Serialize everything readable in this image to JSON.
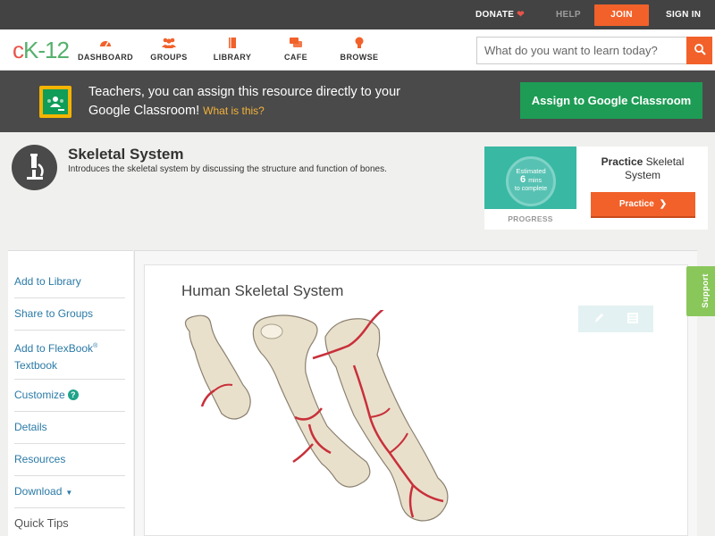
{
  "topbar": {
    "donate": "DONATE",
    "help": "HELP",
    "join": "JOIN",
    "sign_in": "SIGN IN"
  },
  "brand": {
    "logo_c": "c",
    "logo_k": "K",
    "logo_12": "-12",
    "accent_color": "#f2612a",
    "green_color": "#56b06c"
  },
  "nav": {
    "items": [
      {
        "label": "DASHBOARD",
        "icon": "dashboard-gauge-icon"
      },
      {
        "label": "GROUPS",
        "icon": "groups-people-icon"
      },
      {
        "label": "LIBRARY",
        "icon": "library-book-icon"
      },
      {
        "label": "CAFE",
        "icon": "cafe-chat-icon"
      },
      {
        "label": "BROWSE",
        "icon": "browse-bulb-icon"
      }
    ],
    "search_placeholder": "What do you want to learn today?"
  },
  "banner": {
    "text": "Teachers, you can assign this resource directly to your Google Classroom!",
    "what_is_this": "What is this?",
    "assign_button": "Assign to Google Classroom"
  },
  "lesson": {
    "title": "Skeletal System",
    "description": "Introduces the skeletal system by discussing the structure and function of bones."
  },
  "practice_card": {
    "estimated": "Estimated",
    "mins_number": "6",
    "mins_unit": "mins",
    "to_complete": "to complete",
    "progress_label": "PROGRESS",
    "label_bold": "Practice",
    "label_rest": "Skeletal System",
    "button": "Practice"
  },
  "sidebar": {
    "add_library": "Add to Library",
    "share_groups": "Share to Groups",
    "add_flexbook": "Add to FlexBook",
    "add_flexbook_reg": "®",
    "add_flexbook_2": "Textbook",
    "customize": "Customize",
    "customize_help": "?",
    "details": "Details",
    "resources": "Resources",
    "download": "Download",
    "quick_tips": "Quick Tips"
  },
  "content": {
    "image_title": "Human Skeletal System"
  },
  "support": "Support"
}
